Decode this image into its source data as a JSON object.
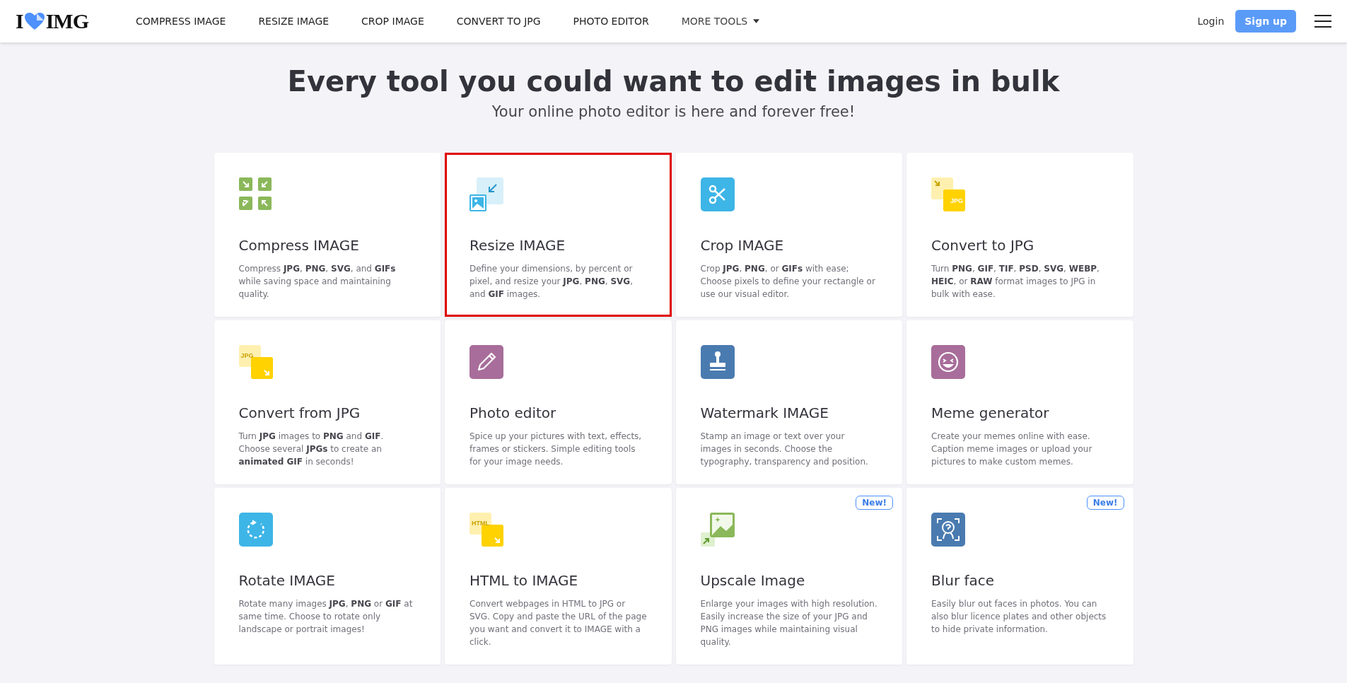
{
  "header": {
    "logo": {
      "left": "I",
      "right": "IMG"
    },
    "nav": [
      {
        "label": "COMPRESS IMAGE"
      },
      {
        "label": "RESIZE IMAGE"
      },
      {
        "label": "CROP IMAGE"
      },
      {
        "label": "CONVERT TO JPG"
      },
      {
        "label": "PHOTO EDITOR"
      },
      {
        "label": "MORE TOOLS",
        "kind": "dropdown"
      }
    ],
    "login": "Login",
    "signup": "Sign up"
  },
  "hero": {
    "title": "Every tool you could want to edit images in bulk",
    "subtitle": "Your online photo editor is here and forever free!"
  },
  "tools": [
    {
      "title": "Compress IMAGE",
      "description": "Compress **JPG**, **PNG**, **SVG**, and **GIFs** while saving space and maintaining quality.",
      "highlighted": false
    },
    {
      "title": "Resize IMAGE",
      "description": "Define your dimensions, by percent or pixel, and resize your **JPG**, **PNG**, **SVG**, and **GIF** images.",
      "highlighted": true
    },
    {
      "title": "Crop IMAGE",
      "description": "Crop **JPG**, **PNG**, or **GIFs** with ease; Choose pixels to define your rectangle or use our visual editor.",
      "highlighted": false
    },
    {
      "title": "Convert to JPG",
      "description": "Turn **PNG**, **GIF**, **TIF**, **PSD**, **SVG**, **WEBP**, **HEIC**, or **RAW** format images to JPG in bulk with ease.",
      "highlighted": false,
      "icon_label": "JPG"
    },
    {
      "title": "Convert from JPG",
      "description": "Turn **JPG** images to **PNG** and **GIF**. Choose several **JPGs** to create an **animated GIF** in seconds!",
      "highlighted": false,
      "icon_label": "JPG"
    },
    {
      "title": "Photo editor",
      "description": "Spice up your pictures with text, effects, frames or stickers. Simple editing tools for your image needs.",
      "highlighted": false
    },
    {
      "title": "Watermark IMAGE",
      "description": "Stamp an image or text over your images in seconds. Choose the typography, transparency and position.",
      "highlighted": false
    },
    {
      "title": "Meme generator",
      "description": "Create your memes online with ease. Caption meme images or upload your pictures to make custom memes.",
      "highlighted": false
    },
    {
      "title": "Rotate IMAGE",
      "description": "Rotate many images **JPG**, **PNG** or **GIF** at same time. Choose to rotate only landscape or portrait images!",
      "highlighted": false
    },
    {
      "title": "HTML to IMAGE",
      "description": "Convert webpages in HTML to JPG or SVG. Copy and paste the URL of the page you want and convert it to IMAGE with a click.",
      "highlighted": false,
      "icon_label": "HTML"
    },
    {
      "title": "Upscale Image",
      "description": "Enlarge your images with high resolution. Easily increase the size of your JPG and PNG images while maintaining visual quality.",
      "highlighted": false,
      "badge": "New!"
    },
    {
      "title": "Blur face",
      "description": "Easily blur out faces in photos. You can also blur licence plates and other objects to hide private information.",
      "highlighted": false,
      "badge": "New!"
    }
  ]
}
